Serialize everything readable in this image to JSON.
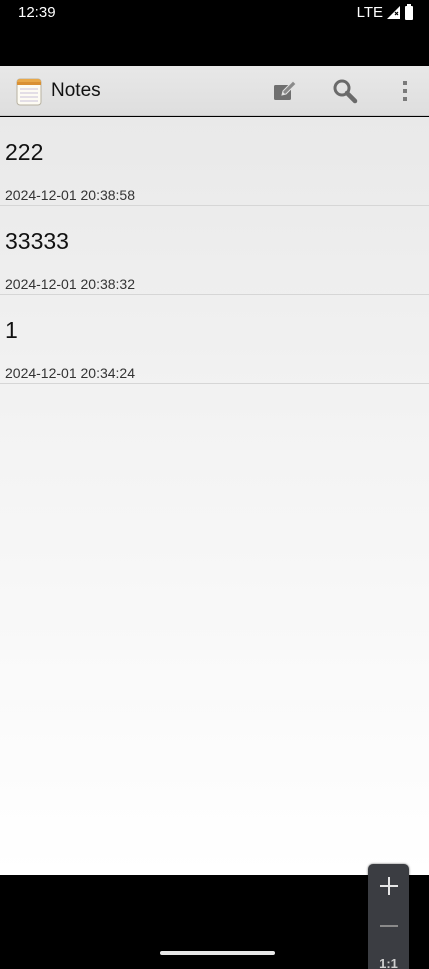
{
  "status_bar": {
    "time": "12:39",
    "network": "LTE",
    "icons": [
      "signal-icon",
      "battery-icon"
    ]
  },
  "action_bar": {
    "title": "Notes",
    "icons": [
      "notepad-app-icon",
      "compose-icon",
      "search-icon",
      "overflow-menu-icon"
    ]
  },
  "notes": [
    {
      "title": "222",
      "date": "2024-12-01 20:38:58"
    },
    {
      "title": "33333",
      "date": "2024-12-01 20:38:32"
    },
    {
      "title": "1",
      "date": "2024-12-01 20:34:24"
    }
  ],
  "zoom_controls": {
    "reset_label": "1:1",
    "icons": [
      "plus-icon",
      "minus-icon"
    ]
  },
  "colors": {
    "status_bar_bg": "#000000",
    "action_bar_bg": "#e3e3e3",
    "list_bg_top": "#e9e9e9",
    "list_bg_bottom": "#ffffff",
    "zoom_panel_bg": "#3b3d42"
  }
}
